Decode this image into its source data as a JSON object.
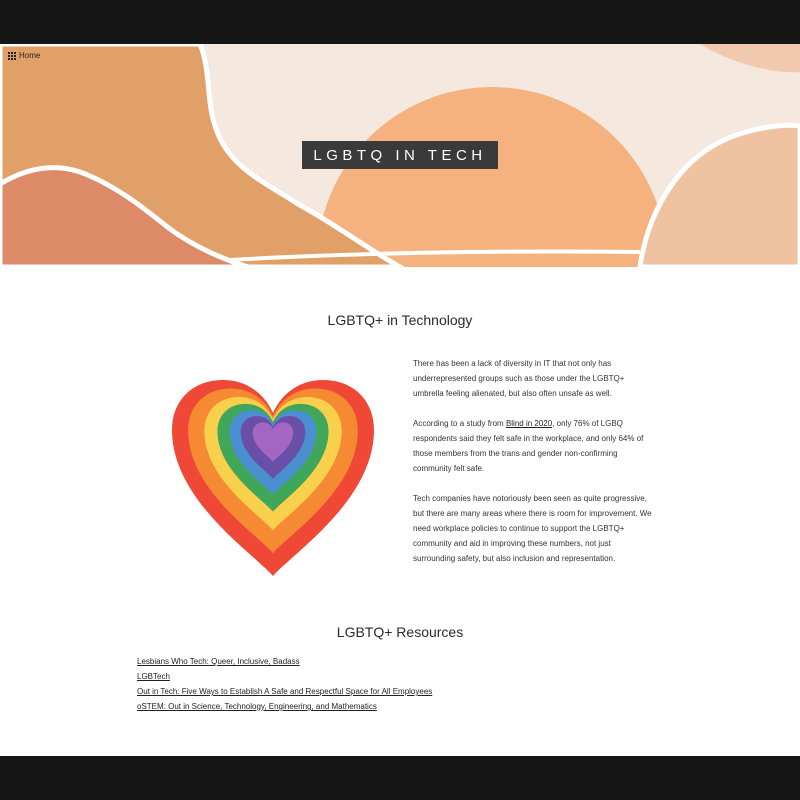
{
  "nav": {
    "home_label": "Home",
    "home_icon": "grid-icon"
  },
  "hero": {
    "title": "LGBTQ IN TECH",
    "colors": {
      "rust": "#dc8a68",
      "ochre": "#e2a069",
      "peach": "#f5b27f",
      "blush": "#efc2a2",
      "cream": "#f4e8df"
    }
  },
  "section_tech": {
    "heading": "LGBTQ+ in Technology",
    "heart_colors": [
      "#ef4836",
      "#f58a33",
      "#f8d04c",
      "#3fa65a",
      "#4a90d0",
      "#6a4fa8",
      "#a366c2"
    ],
    "para1": "There has been a lack of diversity in IT that not only has underrepresented groups such as those under the LGBTQ+ umbrella feeling alienated, but also often unsafe as well.",
    "para2_before": "According to a study from ",
    "para2_link": "Blind in 2020",
    "para2_after": ", only 76% of LGBQ respondents said they felt safe in the workplace, and only 64% of those members from the trans and gender non-confirming community felt safe.",
    "para3": "Tech companies have notoriously been seen as quite progressive, but there are many areas where there is room for improvement. We need workplace policies to continue to support the LGBTQ+ community and aid in improving these numbers, not just surrounding safety, but also inclusion and representation."
  },
  "section_resources": {
    "heading": "LGBTQ+ Resources",
    "links": [
      "Lesbians Who Tech: Queer, Inclusive, Badass",
      "LGBTech",
      "Out in Tech: Five Ways to Establish A Safe and Respectful Space for All Employees",
      "oSTEM: Out in Science, Technology, Engineering, and Mathematics"
    ]
  }
}
